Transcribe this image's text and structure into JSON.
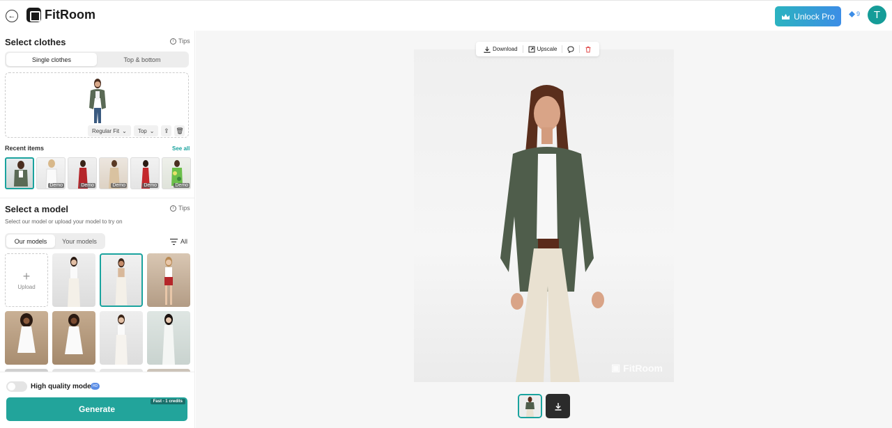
{
  "header": {
    "logo_text": "FitRoom",
    "unlock_label": "Unlock Pro",
    "credits": "9",
    "avatar_initial": "T"
  },
  "clothes": {
    "title": "Select clothes",
    "tips": "Tips",
    "tabs": [
      {
        "label": "Single clothes",
        "active": true
      },
      {
        "label": "Top & bottom",
        "active": false
      }
    ],
    "fit_select": "Regular Fit",
    "type_select": "Top",
    "recent_label": "Recent items",
    "see_all": "See all",
    "recent": [
      {
        "demo": "",
        "selected": true
      },
      {
        "demo": "Demo"
      },
      {
        "demo": "Demo"
      },
      {
        "demo": "Demo"
      },
      {
        "demo": "Demo"
      },
      {
        "demo": "Demo"
      }
    ]
  },
  "model": {
    "title": "Select a model",
    "tips": "Tips",
    "subtitle": "Select our model or upload your model to try on",
    "tabs": [
      {
        "label": "Our models",
        "active": true
      },
      {
        "label": "Your models",
        "active": false
      }
    ],
    "filter": "All",
    "upload_label": "Upload"
  },
  "bottom": {
    "hq_label": "High quality mode",
    "hd_badge": "HD",
    "generate_label": "Generate",
    "fast_badge": "Fast - 1 credits"
  },
  "toolbar": {
    "download": "Download",
    "upscale": "Upscale"
  },
  "watermark": "FitRoom",
  "colors": {
    "accent": "#22a49b",
    "unlock_start": "#2bb3c0",
    "unlock_end": "#3c8de6",
    "avatar": "#159c98"
  }
}
